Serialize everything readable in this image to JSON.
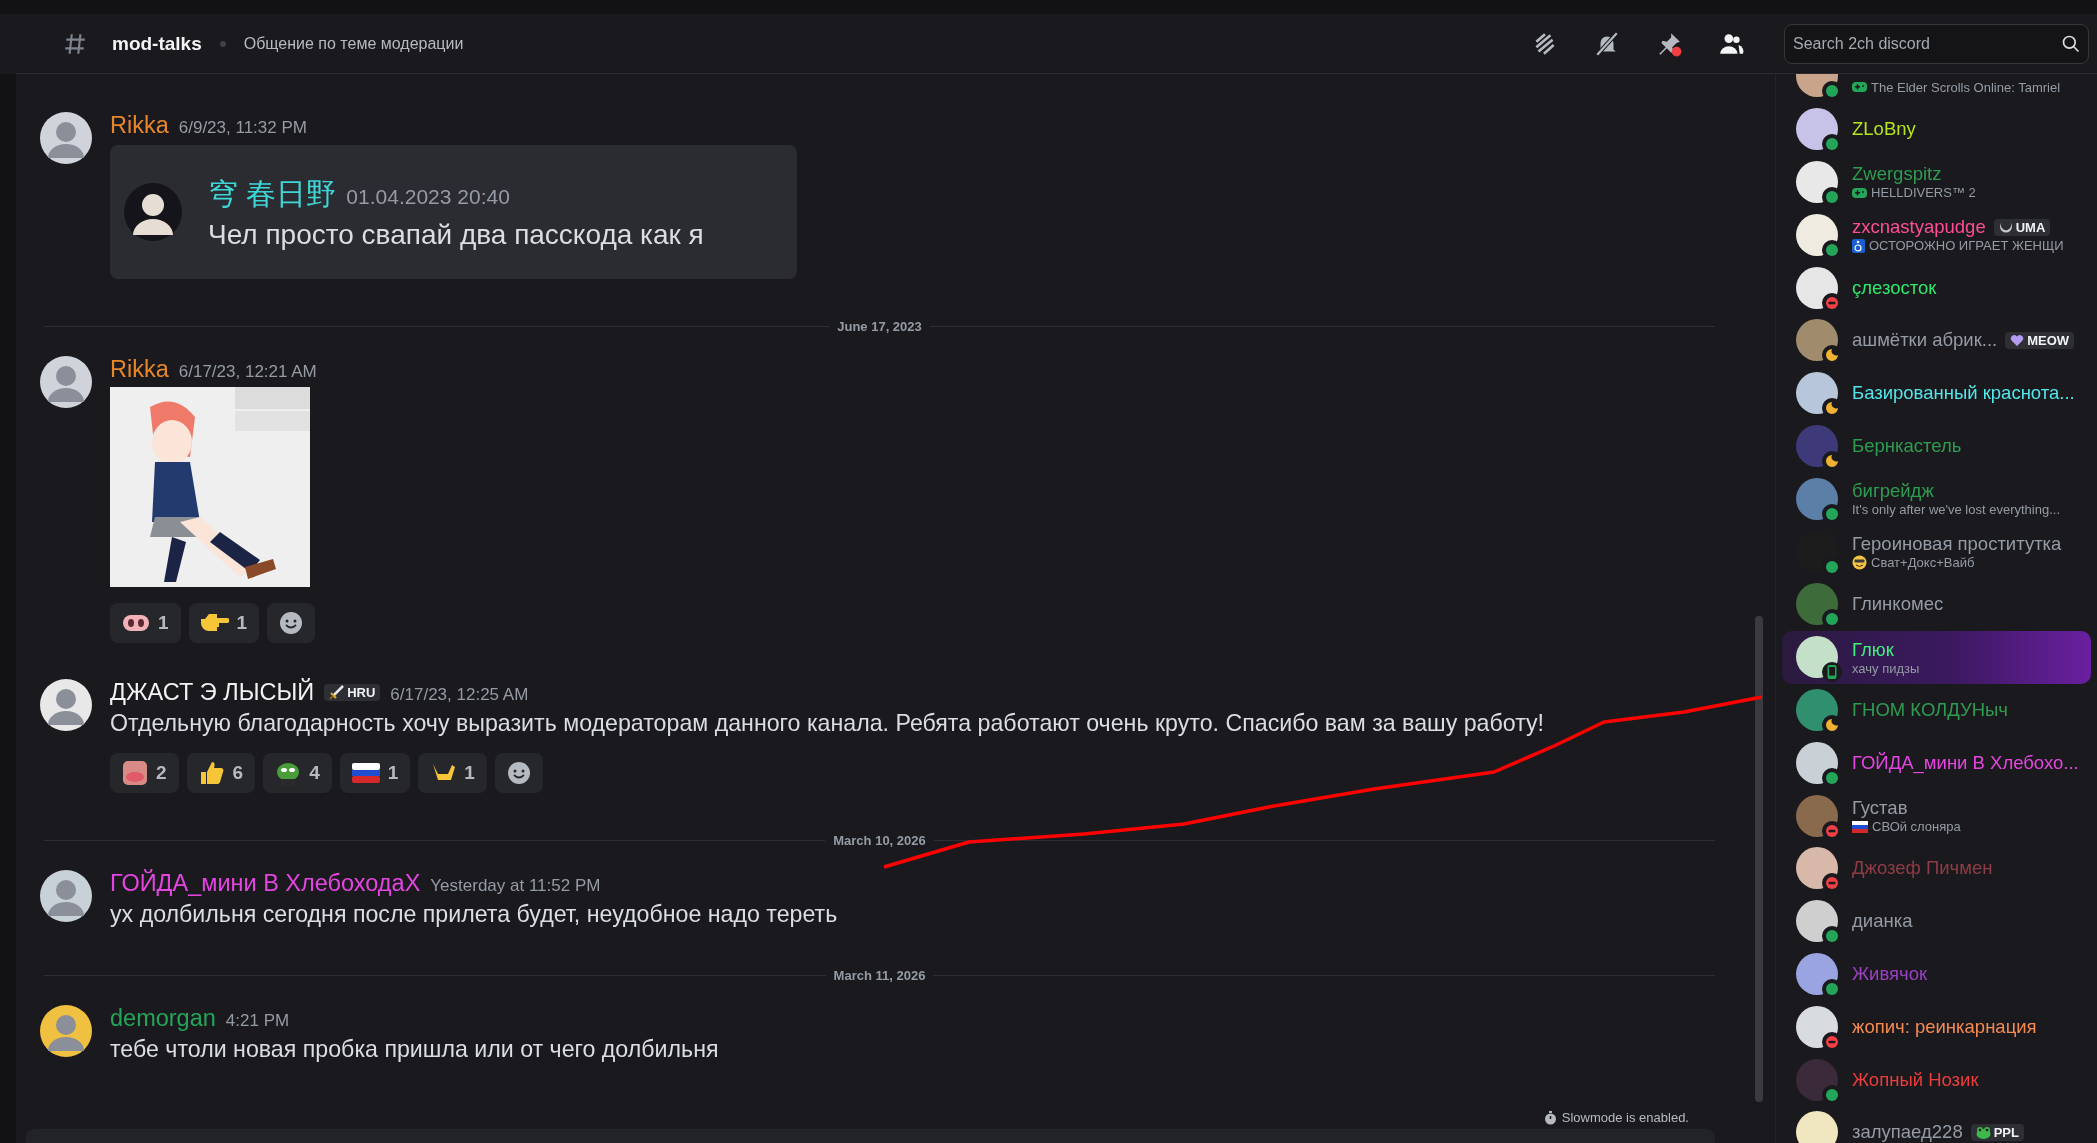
{
  "header": {
    "channel": "mod-talks",
    "topic": "Общение по теме модерации",
    "search": {
      "placeholder": "Search 2ch discord"
    }
  },
  "feed": [
    {
      "kind": "message",
      "author": "Rikka",
      "color": "#e8862a",
      "time": "6/9/23, 11:32 PM",
      "embed": {
        "author": "穹 春日野",
        "color": "#3ed6d6",
        "time": "01.04.2023 20:40",
        "text": "Чел просто свапай два пасскода как я"
      }
    },
    {
      "kind": "divider",
      "text": "June 17, 2023"
    },
    {
      "kind": "message",
      "author": "Rikka",
      "color": "#e8862a",
      "time": "6/17/23, 12:21 AM",
      "reactions": [
        {
          "kind": "snout",
          "count": "1"
        },
        {
          "kind": "pointer",
          "count": "1"
        }
      ]
    },
    {
      "kind": "message",
      "author": "ДЖАСТ Э ЛЫСЫЙ",
      "color": "#f2f3f5",
      "tag": {
        "kind": "sword",
        "text": "HRU"
      },
      "time": "6/17/23, 12:25 AM",
      "text": "Отдельную благодарность хочу выразить модераторам данного канала. Ребята работают очень круто. Спасибо вам за вашу работу!",
      "reactions": [
        {
          "kind": "face",
          "count": "2"
        },
        {
          "kind": "thumbsup",
          "count": "6"
        },
        {
          "kind": "frog",
          "count": "4"
        },
        {
          "kind": "flag",
          "count": "1"
        },
        {
          "kind": "shaka",
          "count": "1"
        }
      ]
    },
    {
      "kind": "divider",
      "text": "March 10, 2026"
    },
    {
      "kind": "message",
      "author": "ГОЙДА_мини В ХлебоходаХ",
      "color": "#e445e0",
      "time": "Yesterday at 11:52 PM",
      "text": "ух долбильня сегодня после прилета будет, неудобное надо тереть"
    },
    {
      "kind": "divider",
      "text": "March 11, 2026"
    },
    {
      "kind": "message",
      "author": "demorgan",
      "color": "#23a55a",
      "time": "4:21 PM",
      "text": "тебе чтоли новая пробка пришла или от чего долбильня"
    }
  ],
  "slowmode": "Slowmode is enabled.",
  "members": [
    {
      "presence": {
        "kind": "online"
      },
      "nameplate": false,
      "activity": {
        "kind": "game",
        "text": "The Elder Scrolls Online: Tamriel"
      }
    },
    {
      "name": "ZLoBny",
      "color": "#b5e61d",
      "presence": {
        "kind": "online"
      },
      "nameplate": false
    },
    {
      "name": "Zwergspitz",
      "color": "#2e9c50",
      "presence": {
        "kind": "online"
      },
      "nameplate": false,
      "activity": {
        "kind": "game",
        "text": "HELLDIVERS™ 2"
      }
    },
    {
      "name": "zxcnastyapudge",
      "color": "#ff4d94",
      "presence": {
        "kind": "online"
      },
      "nameplate": false,
      "tag": {
        "kind": "crescent",
        "text": "UMA"
      },
      "activity": {
        "kind": "accessibility",
        "text": "ОСТОРОЖНО ИГРАЕТ ЖЕНЩИ"
      }
    },
    {
      "name": "çлезосток",
      "color": "#2ee86d",
      "presence": {
        "kind": "dnd"
      },
      "nameplate": false
    },
    {
      "name": "ашмётки абрик...",
      "color": "#949ba4",
      "presence": {
        "kind": "idle"
      },
      "nameplate": false,
      "tag": {
        "kind": "heart",
        "text": "MEOW"
      }
    },
    {
      "name": "Базированный краснота...",
      "color": "#52e6ea",
      "presence": {
        "kind": "idle"
      },
      "nameplate": false
    },
    {
      "name": "Бернкастель",
      "color": "#2e9c50",
      "presence": {
        "kind": "idle"
      },
      "nameplate": false
    },
    {
      "name": "бигрейдж",
      "color": "#2e9c50",
      "presence": {
        "kind": "online"
      },
      "nameplate": false,
      "activity": {
        "kind": "text",
        "text": "It's only after we've lost everything..."
      }
    },
    {
      "name": "Героиновая проститутка",
      "color": "#949ba4",
      "presence": {
        "kind": "online"
      },
      "nameplate": false,
      "activity": {
        "kind": "smiley",
        "text": "Сват+Докс+Вайб"
      }
    },
    {
      "name": "Глинкомес",
      "color": "#949ba4",
      "presence": {
        "kind": "online"
      },
      "nameplate": false
    },
    {
      "name": "Глюк",
      "color": "#3df07c",
      "presence": {
        "kind": "mobile"
      },
      "nameplate": true,
      "activity": {
        "kind": "text",
        "text": "хачу пидзы"
      }
    },
    {
      "name": "ГНОМ КОЛДУНыч",
      "color": "#2e9c50",
      "presence": {
        "kind": "idle"
      },
      "nameplate": false
    },
    {
      "name": "ГОЙДА_мини В Хлебохо...",
      "color": "#e445e0",
      "presence": {
        "kind": "online"
      },
      "nameplate": false
    },
    {
      "name": "Густав",
      "color": "#949ba4",
      "presence": {
        "kind": "dnd"
      },
      "nameplate": false,
      "activity": {
        "kind": "flag",
        "text": "СВОй слоняра"
      }
    },
    {
      "name": "Джозеф Пичмен",
      "color": "#8e3c46",
      "presence": {
        "kind": "dnd"
      },
      "nameplate": false
    },
    {
      "name": "дианка",
      "color": "#949ba4",
      "presence": {
        "kind": "online"
      },
      "nameplate": false
    },
    {
      "name": "Живячок",
      "color": "#9b40c2",
      "presence": {
        "kind": "online"
      },
      "nameplate": false
    },
    {
      "name": "жопич: реинкарнация",
      "color": "#f58a50",
      "presence": {
        "kind": "dnd"
      },
      "nameplate": false
    },
    {
      "name": "Жопный Нозик",
      "color": "#ee3b3b",
      "presence": {
        "kind": "online"
      },
      "nameplate": false
    },
    {
      "name": "залупаед228",
      "color": "#949ba4",
      "nameplate": false,
      "tag": {
        "kind": "frog",
        "text": "PPL"
      }
    }
  ]
}
